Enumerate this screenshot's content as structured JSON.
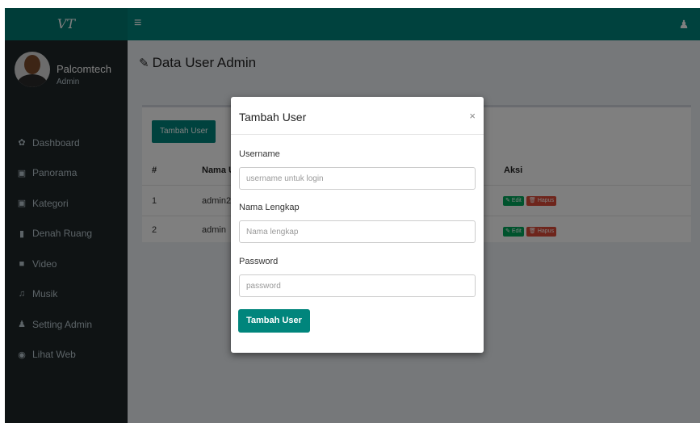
{
  "app": {
    "brand": "VT",
    "menu_icon": "menu-icon",
    "user_icon": "user-icon"
  },
  "sidebar": {
    "user": {
      "name": "Palcomtech",
      "role": "Admin"
    },
    "items": [
      {
        "label": "Dashboard",
        "icon": "dashboard-icon",
        "glyph": "✿"
      },
      {
        "label": "Panorama",
        "icon": "image-icon",
        "glyph": "▣"
      },
      {
        "label": "Kategori",
        "icon": "image-icon",
        "glyph": "▣"
      },
      {
        "label": "Denah Ruang",
        "icon": "map-icon",
        "glyph": "▮"
      },
      {
        "label": "Video",
        "icon": "video-icon",
        "glyph": "■"
      },
      {
        "label": "Musik",
        "icon": "music-icon",
        "glyph": "♫"
      },
      {
        "label": "Setting Admin",
        "icon": "user-icon",
        "glyph": "♟"
      },
      {
        "label": "Lihat Web",
        "icon": "globe-icon",
        "glyph": "◉"
      }
    ]
  },
  "page": {
    "title": "Data User Admin",
    "title_icon": "edit-icon"
  },
  "table": {
    "add_button": "Tambah User",
    "columns": [
      "#",
      "Nama U",
      "Aksi"
    ],
    "rows": [
      {
        "num": "1",
        "name": "admin2",
        "edit": "Edit",
        "delete": "Hapus"
      },
      {
        "num": "2",
        "name": "admin",
        "edit": "Edit",
        "delete": "Hapus"
      }
    ]
  },
  "modal": {
    "title": "Tambah User",
    "close": "×",
    "fields": [
      {
        "label": "Username",
        "placeholder": "username untuk login",
        "value": ""
      },
      {
        "label": "Nama Lengkap",
        "placeholder": "Nama lengkap",
        "value": ""
      },
      {
        "label": "Password",
        "placeholder": "password",
        "value": ""
      }
    ],
    "submit": "Tambah User"
  },
  "colors": {
    "primary": "#00857c",
    "sidebar_bg": "#1e2629",
    "edit": "#00a65a",
    "delete": "#dd4b39"
  }
}
